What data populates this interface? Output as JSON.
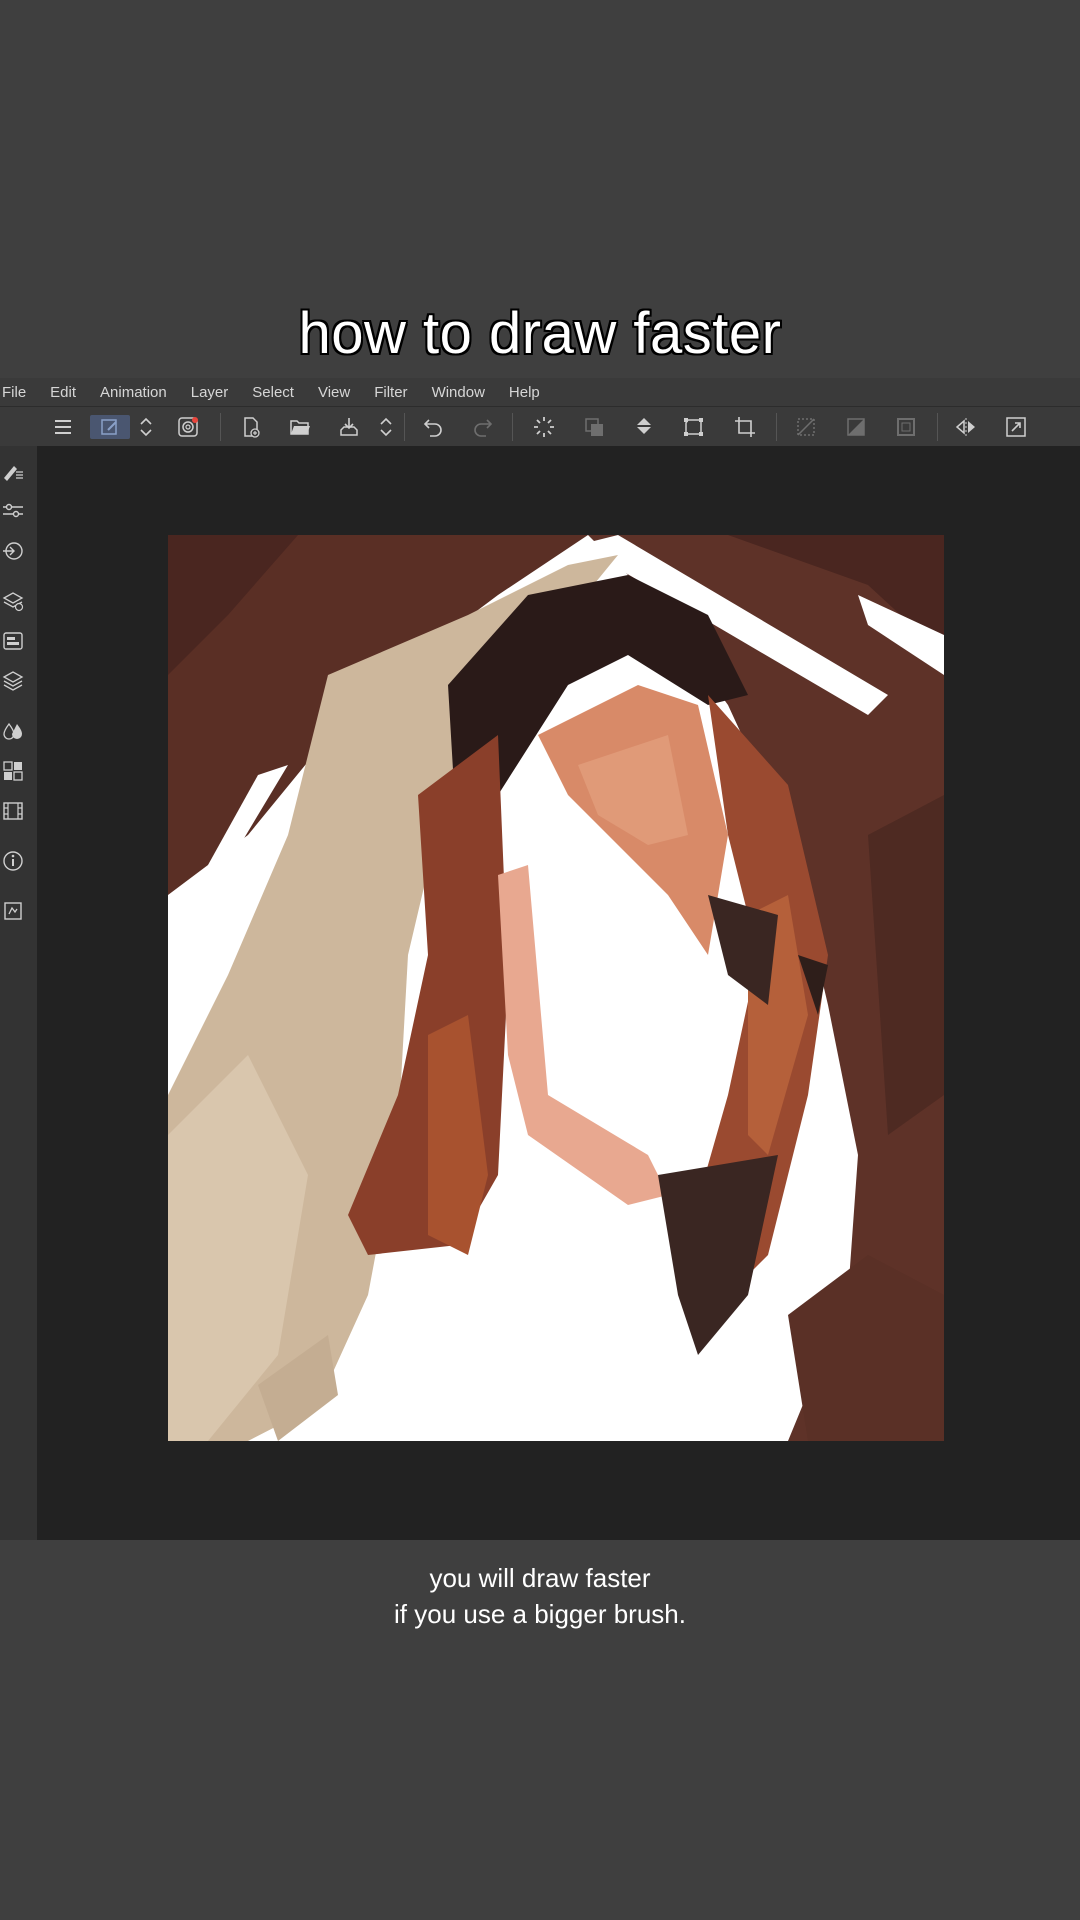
{
  "overlay": {
    "title": "how to draw faster",
    "subtitle_line1": "you will draw faster",
    "subtitle_line2": "if you use a bigger brush."
  },
  "menu": [
    "File",
    "Edit",
    "Animation",
    "Layer",
    "Select",
    "View",
    "Filter",
    "Window",
    "Help"
  ],
  "toolbar": {
    "icons": [
      "menu-icon",
      "pen-tool-icon",
      "stepper-icon",
      "spiral-icon",
      "new-canvas-icon",
      "open-folder-icon",
      "save-icon",
      "stepper-icon",
      "undo-icon",
      "redo-icon",
      "loading-icon",
      "clear-icon",
      "fill-icon",
      "transform-icon",
      "crop-icon",
      "deselect-icon",
      "invert-icon",
      "selection-border-icon",
      "flip-icon",
      "fullscreen-icon"
    ]
  },
  "sidebar": {
    "icons": [
      "brush-tool-icon",
      "sliders-icon",
      "sub-tool-icon",
      "layer-property-icon",
      "navigator-icon",
      "layers-icon",
      "color-icon",
      "material-icon",
      "timeline-icon",
      "info-icon",
      "history-icon"
    ]
  },
  "colors": {
    "background": "#3f3f3f",
    "app_bg": "#222222",
    "toolbar_bg": "#3a3a3a",
    "canvas": "#ffffff",
    "hair_dark": "#4a2a22",
    "hair_mid": "#7a4a3a",
    "skin": "#d07a5a",
    "beige": "#cdb79c"
  }
}
